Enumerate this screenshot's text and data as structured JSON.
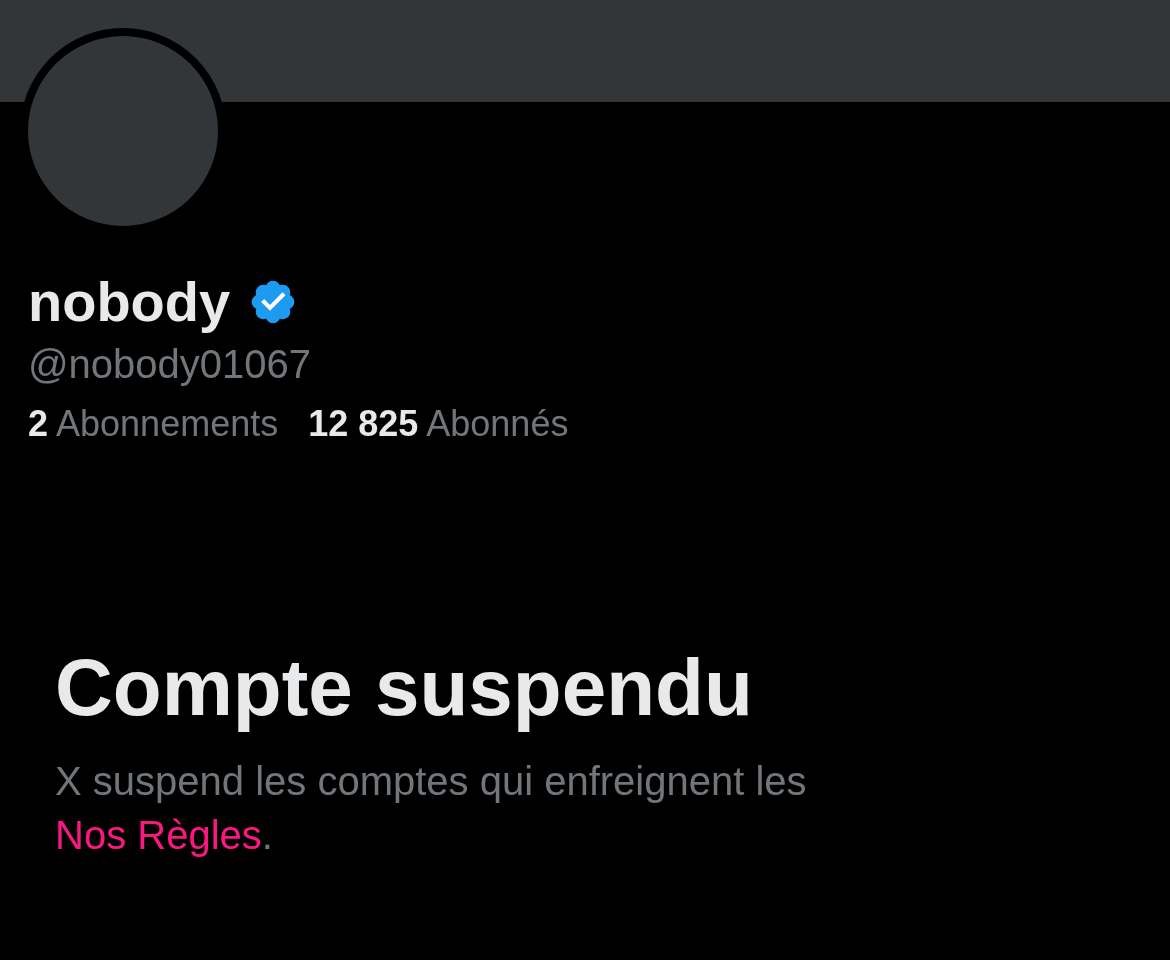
{
  "profile": {
    "name": "nobody",
    "verified": true,
    "handle": "@nobody01067",
    "stats": [
      {
        "count": "2",
        "label": "Abonnements"
      },
      {
        "count": "12 825",
        "label": "Abonnés"
      }
    ]
  },
  "notice": {
    "title": "Compte suspendu",
    "message": "X suspend les comptes qui enfreignent les",
    "link": "Nos Règles",
    "trailing": "."
  }
}
